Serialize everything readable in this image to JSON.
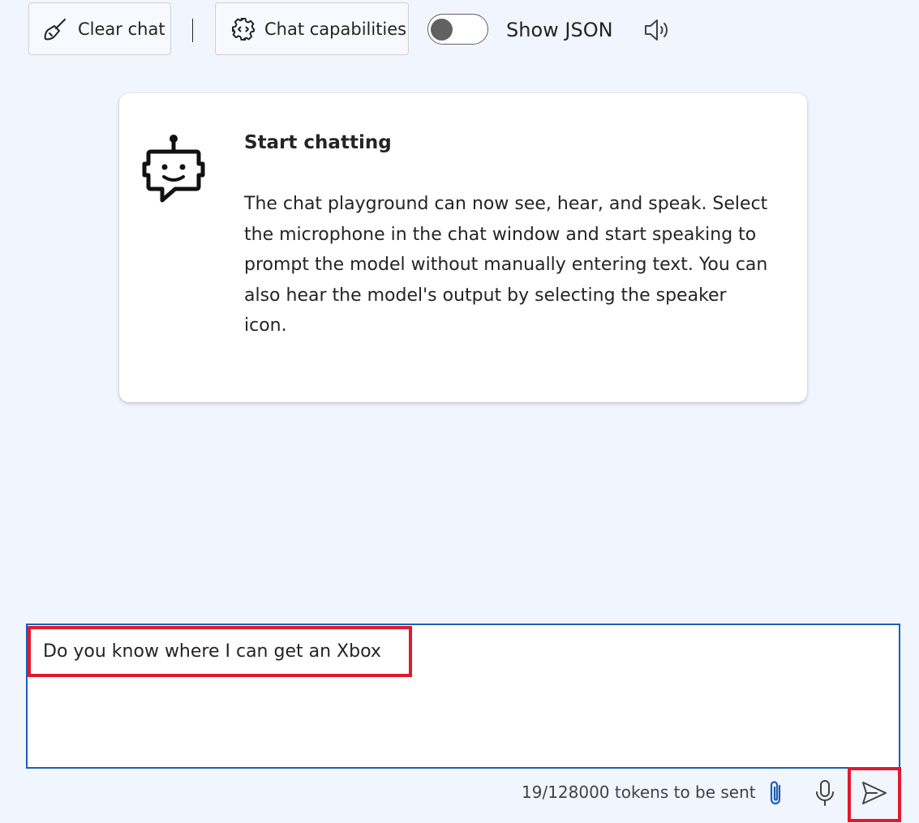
{
  "toolbar": {
    "clear_label": "Clear chat",
    "capabilities_label": "Chat capabilities",
    "show_json_label": "Show JSON",
    "show_json_on": false
  },
  "card": {
    "title": "Start chatting",
    "body": "The chat playground can now see, hear, and speak. Select the microphone in the chat window and start speaking to prompt the model without manually entering text. You can also hear the model's output by selecting the speaker icon."
  },
  "composer": {
    "value": "Do you know where I can get an Xbox",
    "token_status": "19/128000 tokens to be sent"
  },
  "icons": {
    "clear": "broom-icon",
    "capabilities": "gear-icon",
    "speaker": "speaker-icon",
    "bot": "bot-icon",
    "attach": "paperclip-icon",
    "mic": "microphone-icon",
    "send": "send-icon"
  },
  "colors": {
    "background": "#f1f5fd",
    "input_border": "#1a5fb4",
    "highlight": "#e0192d",
    "attach_icon": "#1a5fb4"
  }
}
